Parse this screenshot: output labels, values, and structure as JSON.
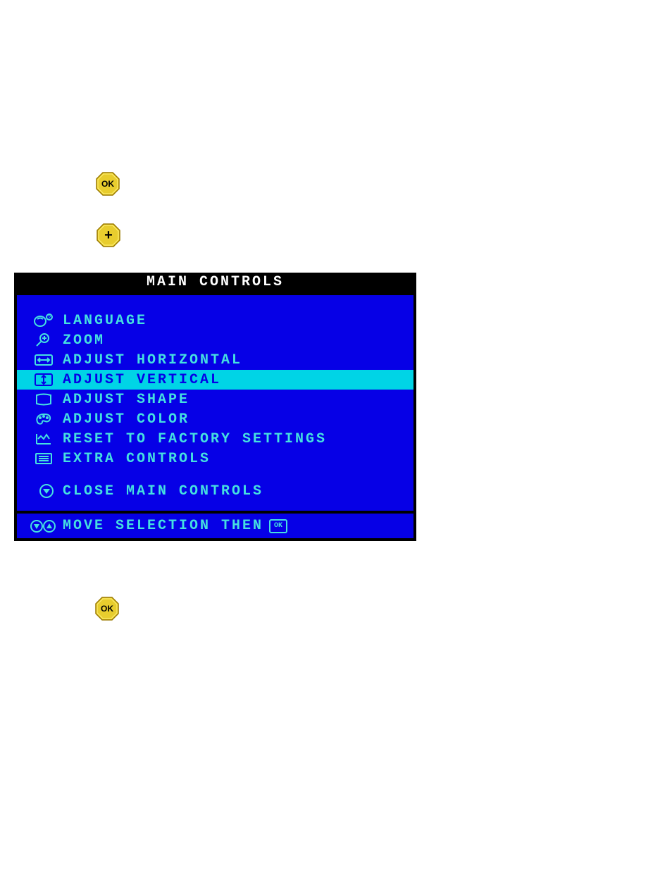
{
  "osd": {
    "title": "MAIN CONTROLS",
    "items": [
      {
        "label": "LANGUAGE",
        "selected": false
      },
      {
        "label": "ZOOM",
        "selected": false
      },
      {
        "label": "ADJUST HORIZONTAL",
        "selected": false
      },
      {
        "label": "ADJUST VERTICAL",
        "selected": true
      },
      {
        "label": "ADJUST SHAPE",
        "selected": false
      },
      {
        "label": "ADJUST COLOR",
        "selected": false
      },
      {
        "label": "RESET TO FACTORY SETTINGS",
        "selected": false
      },
      {
        "label": "EXTRA CONTROLS",
        "selected": false
      }
    ],
    "close_label": "CLOSE MAIN CONTROLS",
    "footer_label": "MOVE SELECTION THEN",
    "footer_ok": "OK"
  }
}
